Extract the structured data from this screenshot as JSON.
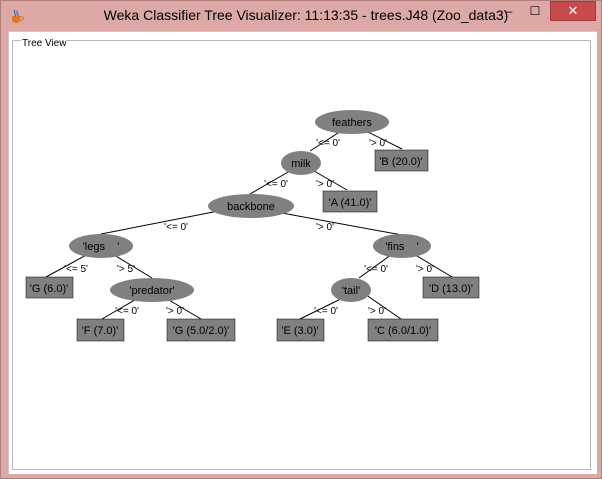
{
  "window": {
    "title": "Weka Classifier Tree Visualizer: 11:13:35 - trees.J48 (Zoo_data3)",
    "buttons": {
      "minimize": "–",
      "maximize": "☐",
      "close": "✕"
    }
  },
  "panel": {
    "title": "Tree View"
  },
  "tree": {
    "nodes": {
      "feathers": "feathers",
      "milk": "milk",
      "backbone": "backbone",
      "legs": "'legs    '",
      "fins": "'fins    '",
      "predator": "'predator'",
      "tail": "'tail'"
    },
    "leaves": {
      "B": "'B (20.0)'",
      "A": "'A (41.0)'",
      "G1": "'G (6.0)'",
      "D": "'D (13.0)'",
      "F": "'F (7.0)'",
      "G2": "'G (5.0/2.0)'",
      "E": "'E (3.0)'",
      "C": "'C (6.0/1.0)'"
    },
    "edges": {
      "feathers_le": "'<= 0'",
      "feathers_gt": "'> 0'",
      "milk_le": "'<= 0'",
      "milk_gt": "'> 0'",
      "backbone_le": "'<= 0'",
      "backbone_gt": "'> 0'",
      "legs_le": "'<= 5'",
      "legs_gt": "'> 5'",
      "fins_le": "'<= 0'",
      "fins_gt": "'> 0'",
      "predator_le": "'<= 0'",
      "predator_gt": "'> 0'",
      "tail_le": "'<= 0'",
      "tail_gt": "'> 0'"
    }
  },
  "colors": {
    "node_fill": "#808080",
    "edge_line": "#000000",
    "title_bar": "#dca9a6",
    "close_button": "#c74b4b"
  }
}
